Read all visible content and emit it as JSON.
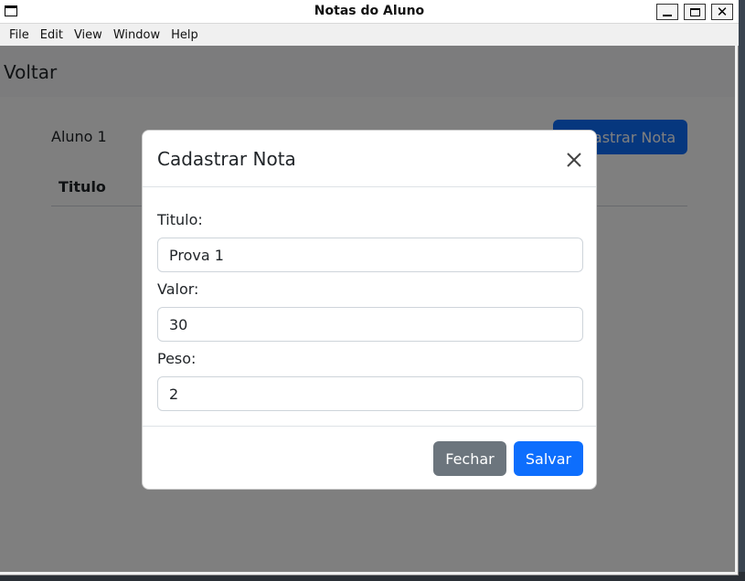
{
  "window": {
    "title": "Notas do Aluno"
  },
  "menu": {
    "items": [
      "File",
      "Edit",
      "View",
      "Window",
      "Help"
    ]
  },
  "page": {
    "back_link": "Voltar",
    "student_name": "Aluno 1",
    "add_grade_button": "Cadastrar Nota",
    "table_headers": [
      "Titulo"
    ]
  },
  "modal": {
    "title": "Cadastrar Nota",
    "close_icon": "close-icon",
    "fields": [
      {
        "label": "Titulo:",
        "value": "Prova 1"
      },
      {
        "label": "Valor:",
        "value": "30"
      },
      {
        "label": "Peso:",
        "value": "2"
      }
    ],
    "close_button": "Fechar",
    "save_button": "Salvar"
  },
  "colors": {
    "primary": "#0d6efd",
    "secondary": "#6c757d",
    "backdrop": "rgba(0,0,0,0.5)"
  }
}
